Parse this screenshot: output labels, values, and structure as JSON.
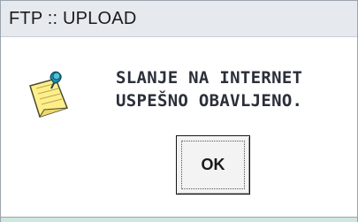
{
  "window": {
    "title": "FTP :: UPLOAD"
  },
  "dialog": {
    "message_lines": [
      "SLANJE NA INTERNET",
      "USPEŠNO OBAVLJENO."
    ],
    "icon": "note-pin-icon"
  },
  "buttons": {
    "ok_label": "OK"
  },
  "colors": {
    "titlebar_bg": "#e6eaef",
    "content_bg": "#ffffff",
    "text": "#2b2f3a",
    "button_border": "#111111",
    "bottom_bar": "#cfe7e0"
  }
}
